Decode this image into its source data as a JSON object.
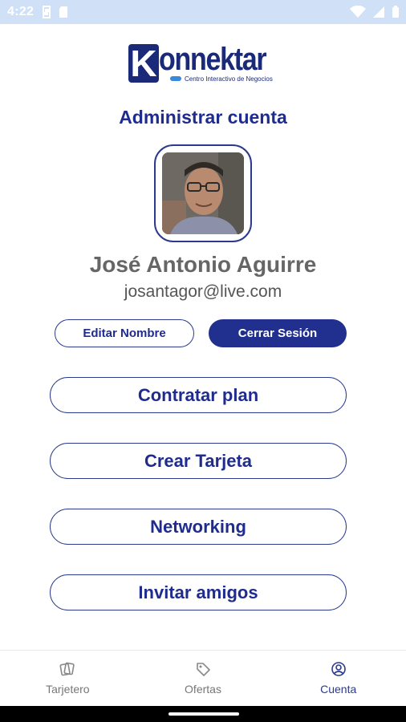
{
  "status_bar": {
    "time": "4:22"
  },
  "brand": {
    "name": "Konnektar",
    "initial": "K",
    "word": "onnektar",
    "tagline": "Centro Interactivo de Negocios"
  },
  "page": {
    "title": "Administrar cuenta"
  },
  "profile": {
    "name": "José Antonio Aguirre",
    "email": "josantagor@live.com"
  },
  "account_actions": {
    "edit_label": "Editar Nombre",
    "logout_label": "Cerrar Sesión"
  },
  "menu": [
    {
      "label": "Contratar plan"
    },
    {
      "label": "Crear Tarjeta"
    },
    {
      "label": "Networking"
    },
    {
      "label": "Invitar amigos"
    }
  ],
  "bottom_nav": [
    {
      "label": "Tarjetero",
      "icon": "cards-icon",
      "active": false
    },
    {
      "label": "Ofertas",
      "icon": "tag-icon",
      "active": false
    },
    {
      "label": "Cuenta",
      "icon": "account-icon",
      "active": true
    }
  ],
  "colors": {
    "primary": "#1f2c8f",
    "status_bar": "#cfe0f7",
    "text_gray": "#666666"
  }
}
